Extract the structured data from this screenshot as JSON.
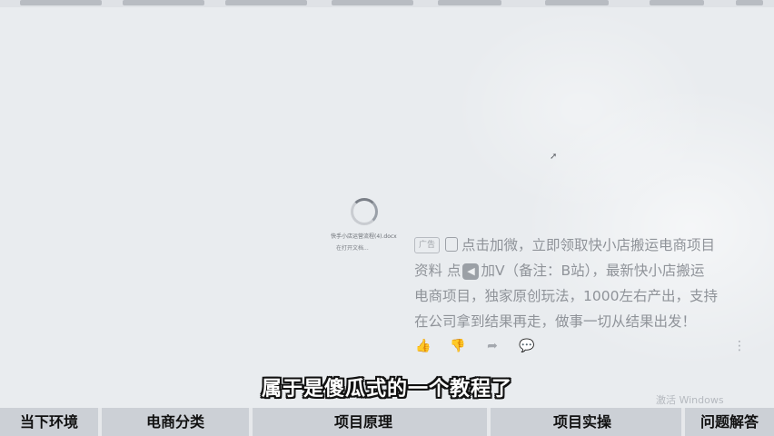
{
  "loading_preview": {
    "file_name": "快手小店运营流程(4).docx",
    "file_action": "在打开文档..."
  },
  "ad": {
    "tag": "广告",
    "lines": [
      "点击加微，立即领取快小店搬运电商项目",
      "资料 点",
      "加V（备注：B站），最新快小店搬运",
      "电商项目，独家原创玩法，1000左右产出，支持",
      "在公司拿到结果再走，做事一切从结果出发！"
    ],
    "icons": [
      "bag-icon",
      "back-arrow-icon"
    ],
    "actions": [
      "like-icon",
      "dislike-icon",
      "share-icon",
      "comment-icon",
      "more-icon"
    ]
  },
  "subtitle": "属于是傻瓜式的一个教程了",
  "watermark": "激活 Windows",
  "bottom_nav": {
    "items": [
      "当下环境",
      "电商分类",
      "项目原理",
      "项目实操",
      "问题解答"
    ]
  }
}
